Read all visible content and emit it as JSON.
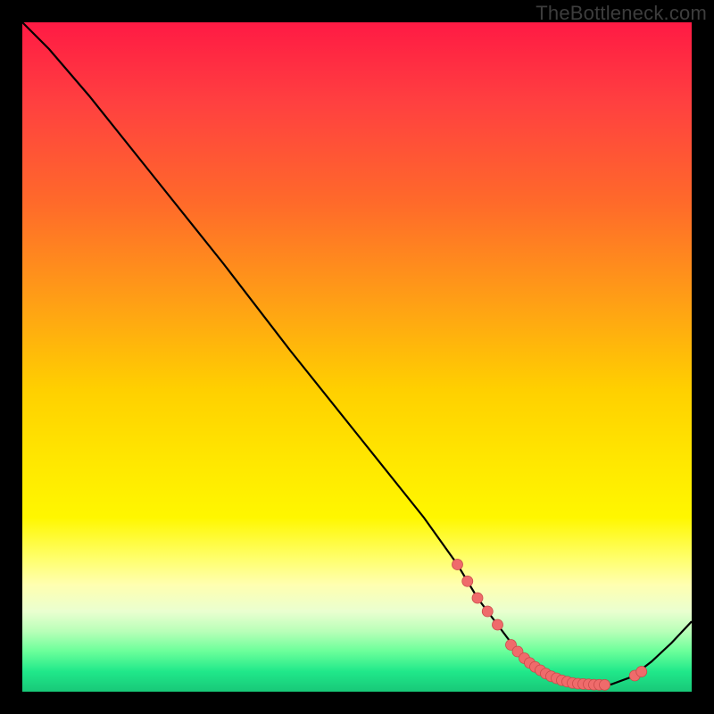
{
  "watermark": "TheBottleneck.com",
  "colors": {
    "curve": "#000000",
    "dot_fill": "#ef6b6b",
    "dot_stroke": "#c94a4a"
  },
  "chart_data": {
    "type": "line",
    "title": "",
    "xlabel": "",
    "ylabel": "",
    "xlim": [
      0,
      100
    ],
    "ylim": [
      0,
      100
    ],
    "grid": false,
    "series": [
      {
        "name": "bottleneck-curve",
        "x": [
          0,
          4,
          10,
          20,
          30,
          40,
          50,
          60,
          65,
          68,
          71,
          74,
          77,
          80,
          83,
          85,
          88,
          91,
          94,
          97,
          100
        ],
        "y": [
          100,
          96,
          89,
          76.5,
          64,
          51,
          38.5,
          26,
          19,
          14,
          10,
          6,
          3.5,
          2,
          1.2,
          1,
          1.1,
          2.2,
          4.5,
          7.3,
          10.5
        ]
      }
    ],
    "scatter": [
      {
        "name": "dot-cluster",
        "x": [
          65.0,
          66.5,
          68.0,
          69.5,
          71.0,
          73.0,
          74.0,
          75.0,
          75.8,
          76.6,
          77.4,
          78.2,
          79.0,
          79.8,
          80.6,
          81.4,
          82.2,
          83.0,
          83.8,
          84.6,
          85.4,
          86.2,
          87.0,
          91.5,
          92.5
        ],
        "y": [
          19.0,
          16.5,
          14.0,
          12.0,
          10.0,
          7.0,
          6.0,
          5.0,
          4.3,
          3.7,
          3.2,
          2.7,
          2.3,
          2.0,
          1.7,
          1.5,
          1.3,
          1.2,
          1.15,
          1.1,
          1.05,
          1.03,
          1.02,
          2.4,
          3.0
        ]
      }
    ]
  }
}
